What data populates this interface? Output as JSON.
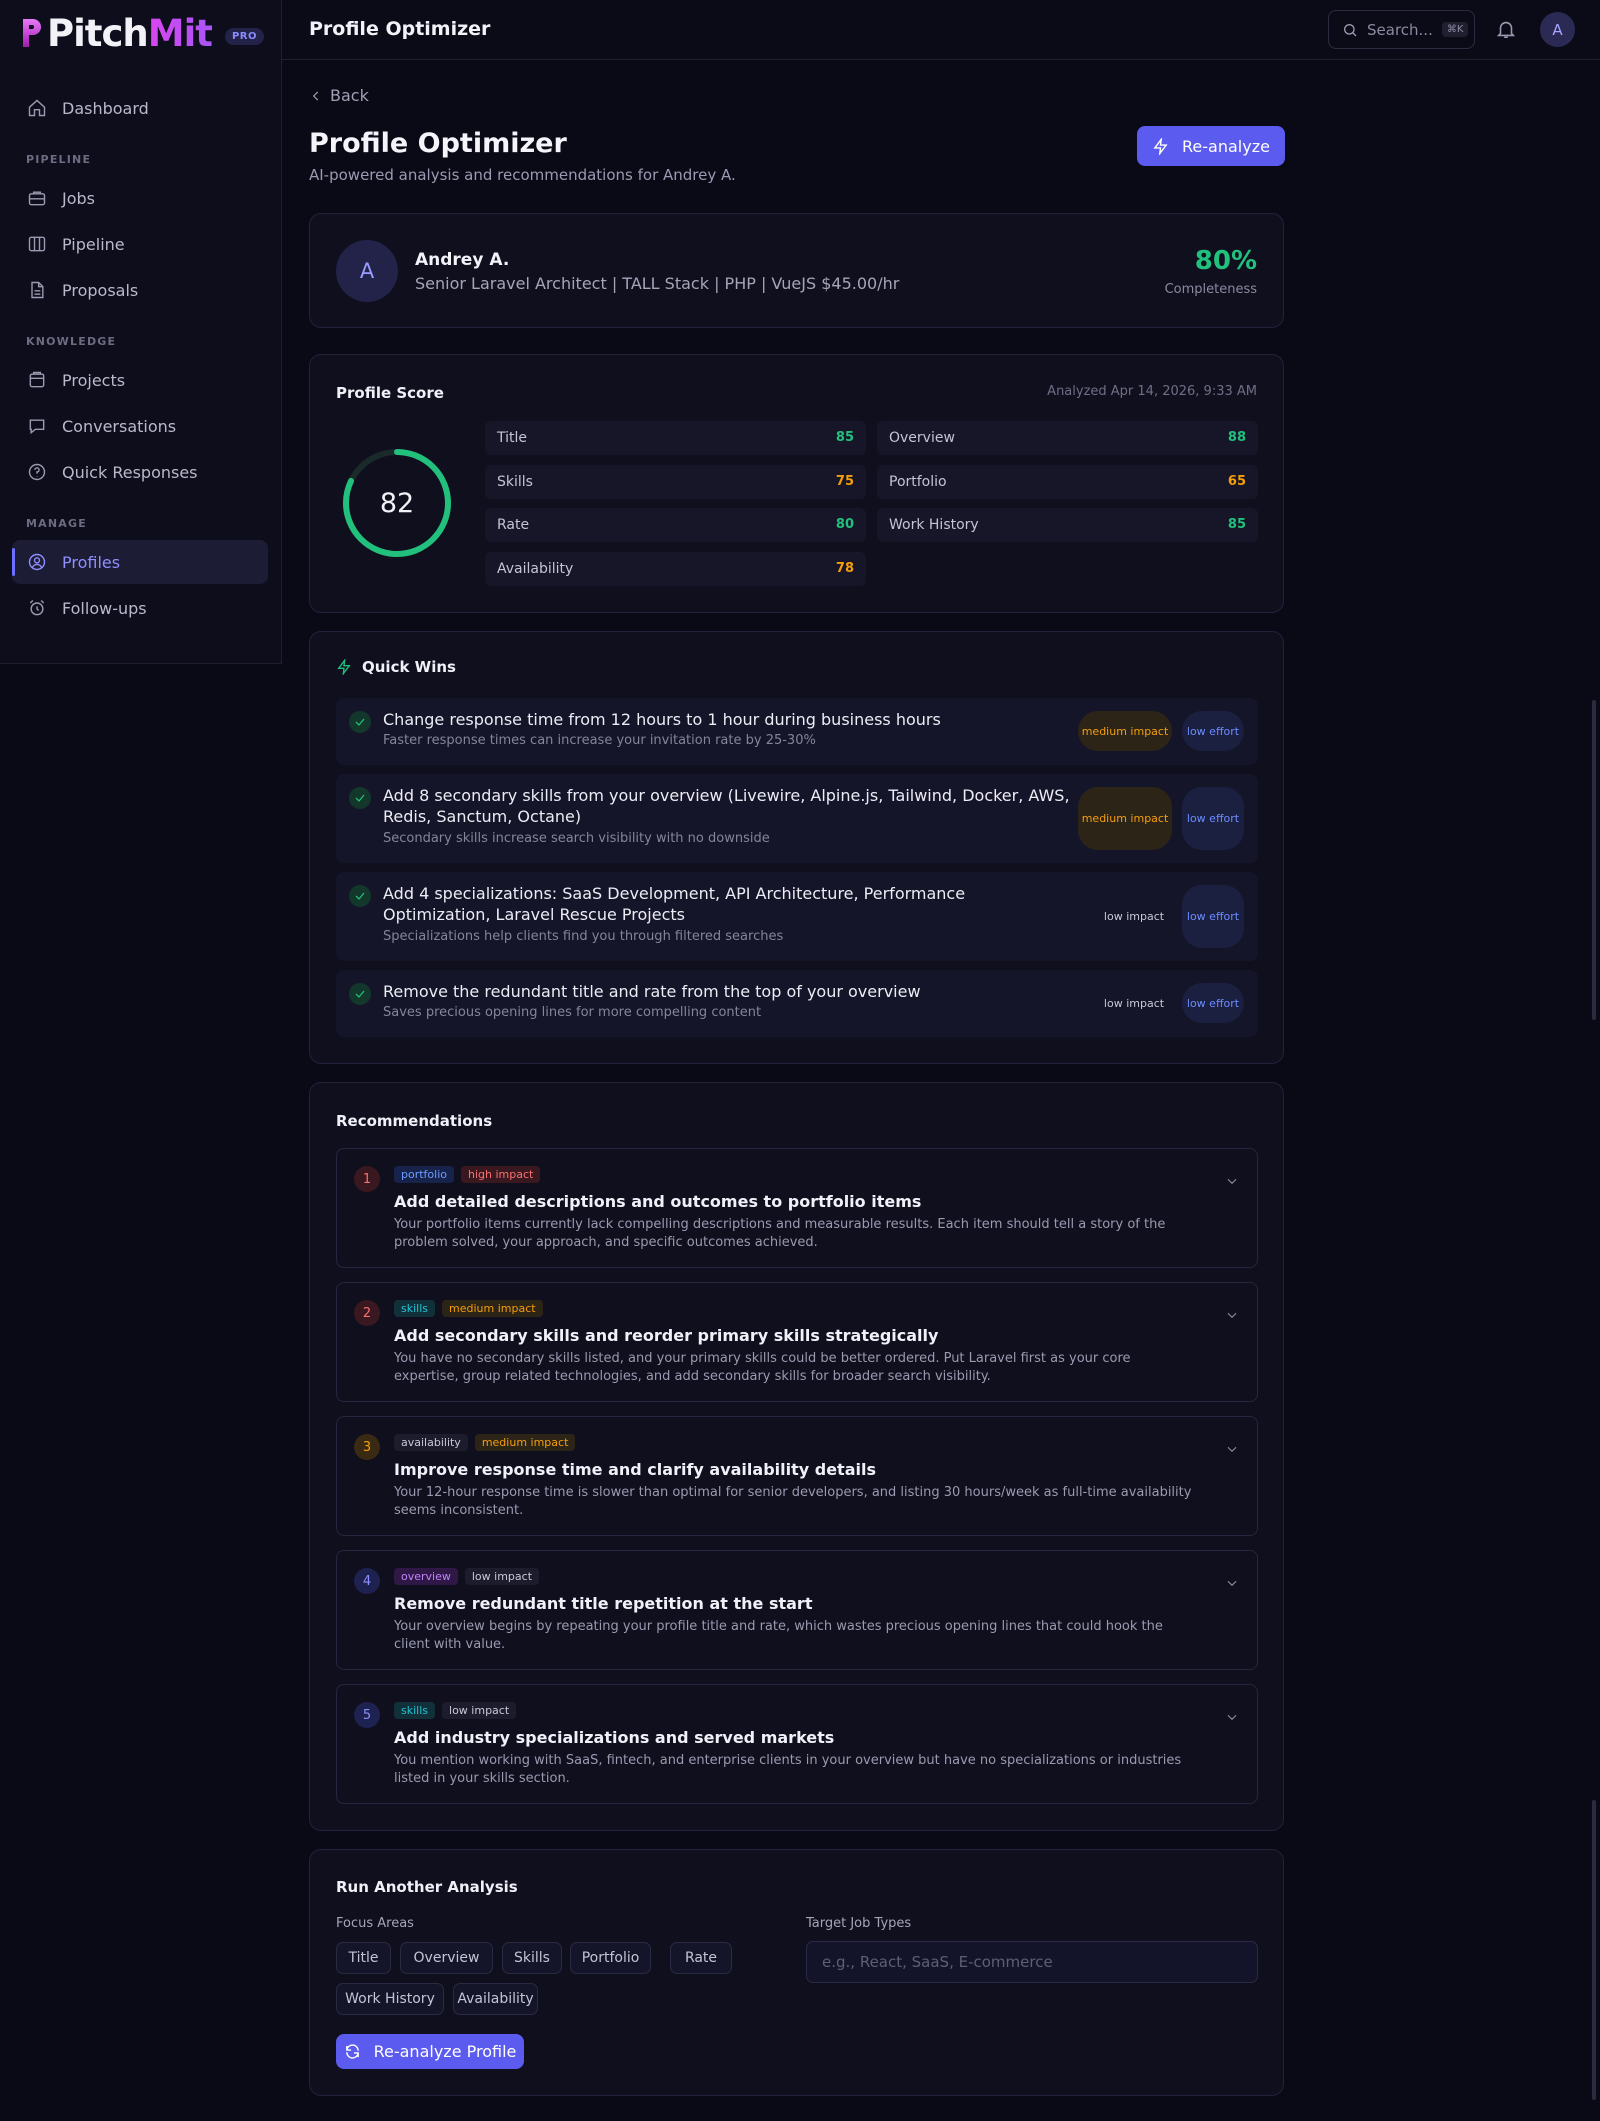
{
  "brand": {
    "name_part1": "Pitch",
    "name_part2": "Mit",
    "badge": "PRO",
    "accent": "#d946ef"
  },
  "sidebar": {
    "sections": {
      "pipeline": "PIPELINE",
      "knowledge": "KNOWLEDGE",
      "manage": "MANAGE"
    },
    "items": [
      {
        "label": "Dashboard",
        "icon": "home-icon"
      },
      {
        "label": "Jobs",
        "icon": "briefcase-icon"
      },
      {
        "label": "Pipeline",
        "icon": "columns-icon"
      },
      {
        "label": "Proposals",
        "icon": "document-icon"
      },
      {
        "label": "Projects",
        "icon": "folder-icon"
      },
      {
        "label": "Conversations",
        "icon": "chat-icon"
      },
      {
        "label": "Quick Responses",
        "icon": "help-circle-icon"
      },
      {
        "label": "Profiles",
        "icon": "user-circle-icon",
        "active": true
      },
      {
        "label": "Follow-ups",
        "icon": "alarm-icon"
      }
    ]
  },
  "topbar": {
    "title": "Profile Optimizer",
    "search_placeholder": "Search...",
    "search_shortcut": "⌘K",
    "avatar_initial": "A"
  },
  "page": {
    "back_label": "Back",
    "title": "Profile Optimizer",
    "subtitle": "AI-powered analysis and recommendations for Andrey A.",
    "reanalyze_label": "Re-analyze"
  },
  "profile": {
    "initial": "A",
    "name": "Andrey A.",
    "headline": "Senior Laravel Architect | TALL Stack | PHP | VueJS $45.00/hr",
    "completeness": "80%",
    "completeness_label": "Completeness"
  },
  "score": {
    "title": "Profile Score",
    "analyzed": "Analyzed Apr 14, 2026, 9:33 AM",
    "overall": "82",
    "overall_value": 82,
    "rows": [
      {
        "label": "Title",
        "value": "85",
        "color": "green"
      },
      {
        "label": "Overview",
        "value": "88",
        "color": "green"
      },
      {
        "label": "Skills",
        "value": "75",
        "color": "orange"
      },
      {
        "label": "Portfolio",
        "value": "65",
        "color": "orange"
      },
      {
        "label": "Rate",
        "value": "80",
        "color": "green"
      },
      {
        "label": "Work History",
        "value": "85",
        "color": "green"
      },
      {
        "label": "Availability",
        "value": "78",
        "color": "orange"
      }
    ]
  },
  "quick_wins": {
    "title": "Quick Wins",
    "items": [
      {
        "title": "Change response time from 12 hours to 1 hour during business hours",
        "desc": "Faster response times can increase your invitation rate by 25-30%",
        "impact": "medium impact",
        "effort": "low effort"
      },
      {
        "title": "Add 8 secondary skills from your overview (Livewire, Alpine.js, Tailwind, Docker, AWS, Redis, Sanctum, Octane)",
        "desc": "Secondary skills increase search visibility with no downside",
        "impact": "medium impact",
        "effort": "low effort"
      },
      {
        "title": "Add 4 specializations: SaaS Development, API Architecture, Performance Optimization, Laravel Rescue Projects",
        "desc": "Specializations help clients find you through filtered searches",
        "impact": "low impact",
        "effort": "low effort"
      },
      {
        "title": "Remove the redundant title and rate from the top of your overview",
        "desc": "Saves precious opening lines for more compelling content",
        "impact": "low impact",
        "effort": "low effort"
      }
    ]
  },
  "recommendations": {
    "title": "Recommendations",
    "items": [
      {
        "num": "1",
        "category": "portfolio",
        "impact": "high impact",
        "title": "Add detailed descriptions and outcomes to portfolio items",
        "desc": "Your portfolio items currently lack compelling descriptions and measurable results. Each item should tell a story of the problem solved, your approach, and specific outcomes achieved."
      },
      {
        "num": "2",
        "category": "skills",
        "impact": "medium impact",
        "title": "Add secondary skills and reorder primary skills strategically",
        "desc": "You have no secondary skills listed, and your primary skills could be better ordered. Put Laravel first as your core expertise, group related technologies, and add secondary skills for broader search visibility."
      },
      {
        "num": "3",
        "category": "availability",
        "impact": "medium impact",
        "title": "Improve response time and clarify availability details",
        "desc": "Your 12-hour response time is slower than optimal for senior developers, and listing 30 hours/week as full-time availability seems inconsistent."
      },
      {
        "num": "4",
        "category": "overview",
        "impact": "low impact",
        "title": "Remove redundant title repetition at the start",
        "desc": "Your overview begins by repeating your profile title and rate, which wastes precious opening lines that could hook the client with value."
      },
      {
        "num": "5",
        "category": "skills",
        "impact": "low impact",
        "title": "Add industry specializations and served markets",
        "desc": "You mention working with SaaS, fintech, and enterprise clients in your overview but have no specializations or industries listed in your skills section."
      }
    ]
  },
  "run_analysis": {
    "title": "Run Another Analysis",
    "focus_label": "Focus Areas",
    "focus_areas": [
      "Title",
      "Overview",
      "Skills",
      "Portfolio",
      "Rate",
      "Work History",
      "Availability"
    ],
    "target_label": "Target Job Types",
    "target_placeholder": "e.g., React, SaaS, E-commerce",
    "button_label": "Re-analyze Profile"
  }
}
